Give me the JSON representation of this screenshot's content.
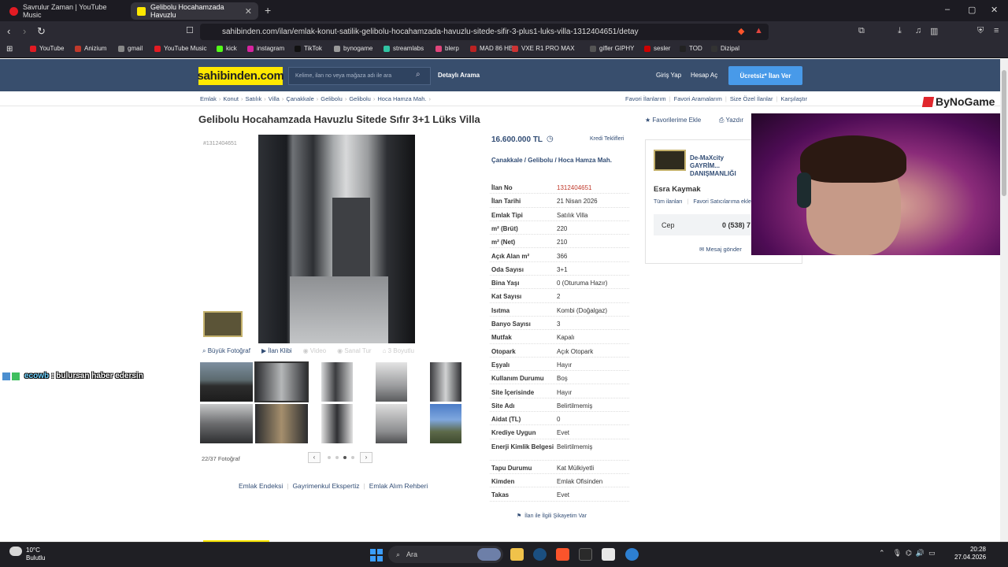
{
  "browser": {
    "tabs": [
      {
        "title": "Savrulur Zaman | YouTube Music",
        "color": "#e21b23"
      },
      {
        "title": "Gelibolu Hocahamzada Havuzlu",
        "color": "#ffe800"
      }
    ],
    "new_tab": "+",
    "window_controls": [
      "–",
      "▢",
      "✕"
    ],
    "url": "sahibinden.com/ilan/emlak-konut-satilik-gelibolu-hocahamzada-havuzlu-sitede-sifir-3-plus1-luks-villa-1312404651/detay",
    "bookmarks": [
      {
        "label": "YouTube",
        "color": "#e21b23"
      },
      {
        "label": "Anizium",
        "color": "#c0392b"
      },
      {
        "label": "gmail",
        "color": "#888"
      },
      {
        "label": "YouTube Music",
        "color": "#e21b23"
      },
      {
        "label": "kick",
        "color": "#53fc18"
      },
      {
        "label": "instagram",
        "color": "#d6249f"
      },
      {
        "label": "TikTok",
        "color": "#111"
      },
      {
        "label": "bynogame",
        "color": "#999"
      },
      {
        "label": "streamlabs",
        "color": "#31c3a2"
      },
      {
        "label": "blerp",
        "color": "#e0457b"
      },
      {
        "label": "MAD 86 HE",
        "color": "#b22"
      },
      {
        "label": "VXE R1 PRO MAX",
        "color": "#c33"
      },
      {
        "label": "gifler GIPHY",
        "color": "#555"
      },
      {
        "label": "sesler",
        "color": "#c00"
      },
      {
        "label": "TOD",
        "color": "#222"
      },
      {
        "label": "Dizipal",
        "color": "#333"
      }
    ]
  },
  "site": {
    "logo": "sahibinden.com",
    "search_placeholder": "Kelime, ilan no veya mağaza adı ile ara",
    "detailed_search": "Detaylı Arama",
    "login": "Giriş Yap",
    "register": "Hesap Aç",
    "free_ad": "Ücretsiz* İlan Ver",
    "breadcrumbs": [
      "Emlak",
      "Konut",
      "Satılık",
      "Villa",
      "Çanakkale",
      "Gelibolu",
      "Gelibolu",
      "Hoca Hamza Mah."
    ],
    "top_links": [
      "Favori İlanlarım",
      "Favori Aramalarım",
      "Size Özel İlanlar",
      "Karşılaştır"
    ],
    "partner_logo": "ByNoGame"
  },
  "listing": {
    "title": "Gelibolu Hocahamzada Havuzlu Sitede Sıfır 3+1 Lüks Villa",
    "add_favorite": "Favorilerime Ekle",
    "print": "Yazdır",
    "ad_id": "#1312404651",
    "price": "16.600.000 TL",
    "credit_offers": "Kredi Teklifleri",
    "location": "Çanakkale  /  Gelibolu  /  Hoca Hamza Mah.",
    "photo_tools": [
      "Büyük Fotoğraf",
      "İlan Klibi",
      "Video",
      "Sanal Tur",
      "3 Boyutlu"
    ],
    "photo_counter": "22/37 Fotoğraf",
    "page_dots": 4,
    "active_dot": 3,
    "bottom_links": [
      "Emlak Endeksi",
      "Gayrimenkul Ekspertiz",
      "Emlak Alım Rehberi"
    ],
    "complaint": "İlan ile İlgili Şikayetim Var",
    "details": [
      {
        "k": "İlan No",
        "v": "1312404651",
        "accent": true
      },
      {
        "k": "İlan Tarihi",
        "v": "21 Nisan 2026"
      },
      {
        "k": "Emlak Tipi",
        "v": "Satılık Villa"
      },
      {
        "k": "m² (Brüt)",
        "v": "220"
      },
      {
        "k": "m² (Net)",
        "v": "210"
      },
      {
        "k": "Açık Alan m²",
        "v": "366"
      },
      {
        "k": "Oda Sayısı",
        "v": "3+1"
      },
      {
        "k": "Bina Yaşı",
        "v": "0 (Oturuma Hazır)"
      },
      {
        "k": "Kat Sayısı",
        "v": "2"
      },
      {
        "k": "Isıtma",
        "v": "Kombi (Doğalgaz)"
      },
      {
        "k": "Banyo Sayısı",
        "v": "3"
      },
      {
        "k": "Mutfak",
        "v": "Kapalı"
      },
      {
        "k": "Otopark",
        "v": "Açık Otopark"
      },
      {
        "k": "Eşyalı",
        "v": "Hayır"
      },
      {
        "k": "Kullanım Durumu",
        "v": "Boş"
      },
      {
        "k": "Site İçerisinde",
        "v": "Hayır"
      },
      {
        "k": "Site Adı",
        "v": "Belirtilmemiş"
      },
      {
        "k": "Aidat (TL)",
        "v": "0"
      },
      {
        "k": "Krediye Uygun",
        "v": "Evet"
      },
      {
        "k": "Enerji Kimlik Belgesi",
        "v": "Belirtilmemiş"
      },
      {
        "k": "Tapu Durumu",
        "v": "Kat Mülkiyetli"
      },
      {
        "k": "Kimden",
        "v": "Emlak Ofisinden"
      },
      {
        "k": "Takas",
        "v": "Evet"
      }
    ]
  },
  "seller": {
    "agency": "De-MaXcity GAYRİM... DANIŞMANLIĞI",
    "agent": "Esra Kaymak",
    "all_listings": "Tüm ilanları",
    "fav_seller": "Favori Satıcılarıma ekle",
    "phone_label": "Cep",
    "phone": "0 (538) 7",
    "message": "Mesaj gönder"
  },
  "overlay": {
    "chat_user": "ecowb",
    "chat_message": ": bulursan haber edersin"
  },
  "taskbar": {
    "weather_temp": "10°C",
    "weather_desc": "Bulutlu",
    "search": "Ara",
    "time": "20:28",
    "date": "27.04.2026"
  }
}
